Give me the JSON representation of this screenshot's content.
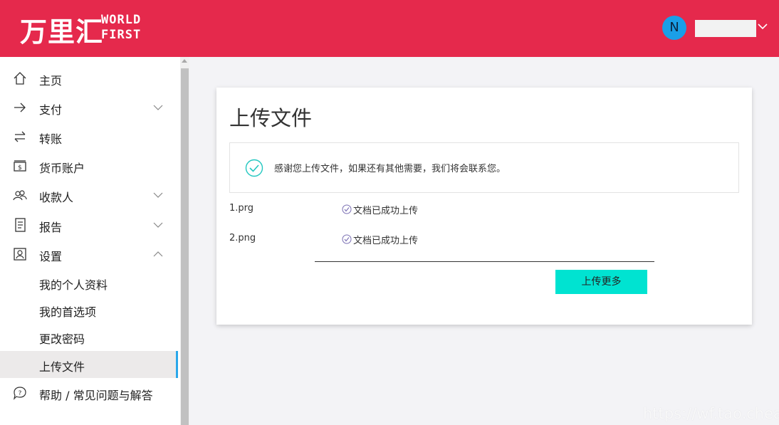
{
  "header": {
    "logo_cn": "万里汇",
    "logo_en_line1": "WORLD",
    "logo_en_line2": "FIRST",
    "avatar_letter": "N",
    "brand_color": "#e5294c"
  },
  "sidebar": {
    "items": [
      {
        "label": "主页",
        "icon": "home-icon"
      },
      {
        "label": "支付",
        "icon": "arrow-right-icon",
        "expandable": true,
        "expanded": false
      },
      {
        "label": "转账",
        "icon": "transfer-icon"
      },
      {
        "label": "货币账户",
        "icon": "currency-account-icon"
      },
      {
        "label": "收款人",
        "icon": "payees-icon",
        "expandable": true,
        "expanded": false
      },
      {
        "label": "报告",
        "icon": "report-icon",
        "expandable": true,
        "expanded": false
      },
      {
        "label": "设置",
        "icon": "settings-icon",
        "expandable": true,
        "expanded": true
      },
      {
        "label": "帮助 / 常见问题与解答",
        "icon": "help-icon"
      }
    ],
    "settings_subitems": [
      {
        "label": "我的个人资料"
      },
      {
        "label": "我的首选项"
      },
      {
        "label": "更改密码"
      },
      {
        "label": "上传文件",
        "active": true
      }
    ],
    "active_color": "#2aa7ea"
  },
  "main": {
    "title": "上传文件",
    "notice": "感谢您上传文件，如果还有其他需要，我们将会联系您。",
    "files": [
      {
        "name": "1.prg",
        "status": "文档已成功上传"
      },
      {
        "name": "2.png",
        "status": "文档已成功上传"
      }
    ],
    "upload_more_label": "上传更多",
    "button_color": "#00e3d1"
  },
  "watermark": "https://wf.tao.cheap"
}
